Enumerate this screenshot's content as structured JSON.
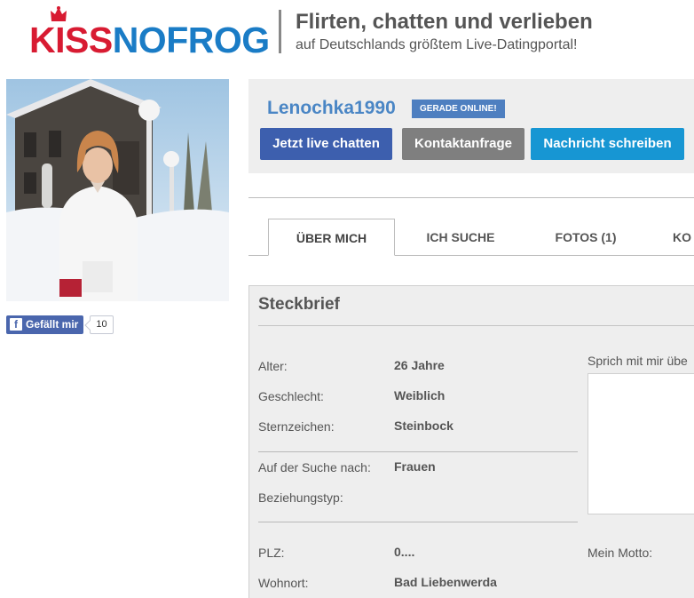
{
  "header": {
    "logo_kiss": "KISS",
    "logo_nofrog": "NOFROG",
    "title": "Flirten, chatten und verlieben",
    "subtitle": "auf Deutschlands größtem Live-Datingportal!"
  },
  "colors": {
    "brand_red": "#d81b32",
    "brand_blue": "#1a7cc6",
    "chat_button": "#3d5fae",
    "contact_button": "#7f7f7f",
    "message_button": "#1796d3",
    "online_badge": "#4e7fc0"
  },
  "profile": {
    "username": "Lenochka1990",
    "online_badge": "GERADE ONLINE!",
    "buttons": {
      "chat": "Jetzt live chatten",
      "contact": "Kontaktanfrage",
      "message": "Nachricht schreiben"
    }
  },
  "facebook": {
    "like_label": "Gefällt mir",
    "like_count": "10"
  },
  "tabs": [
    {
      "label": "ÜBER MICH",
      "active": true
    },
    {
      "label": "ICH SUCHE",
      "active": false
    },
    {
      "label": "FOTOS (1)",
      "active": false
    },
    {
      "label": "KO",
      "active": false
    }
  ],
  "steckbrief": {
    "title": "Steckbrief",
    "rows": [
      {
        "label": "Alter:",
        "value": "26 Jahre"
      },
      {
        "label": "Geschlecht:",
        "value": "Weiblich"
      },
      {
        "label": "Sternzeichen:",
        "value": "Steinbock"
      },
      {
        "label": "Auf der Suche nach:",
        "value": "Frauen"
      },
      {
        "label": "Beziehungstyp:",
        "value": ""
      },
      {
        "label": "PLZ:",
        "value": "0...."
      },
      {
        "label": "Wohnort:",
        "value": "Bad Liebenwerda"
      }
    ],
    "talk_about_label": "Sprich mit mir übe",
    "motto_label": "Mein Motto:"
  }
}
